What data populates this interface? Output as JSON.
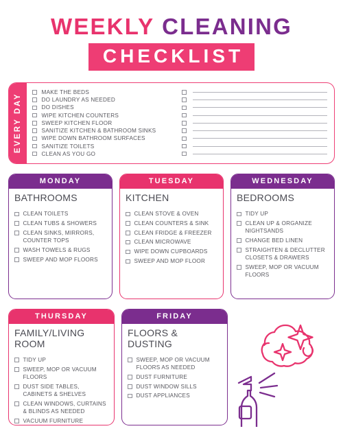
{
  "title": {
    "word1": "WEEKLY",
    "word2": "CLEANING",
    "banner": "CHECKLIST",
    "color_pink": "#e8336d",
    "color_purple": "#7b2d8e",
    "color_banner": "#ee3d74"
  },
  "every_day": {
    "label": "EVERY DAY",
    "tasks_left": [
      "MAKE THE BEDS",
      "DO LAUNDRY AS NEEDED",
      "DO DISHES",
      "WIPE KITCHEN COUNTERS",
      "SWEEP KITCHEN FLOOR",
      "SANITIZE KITCHEN & BATHROOM SINKS",
      "WIPE DOWN BATHROOM SURFACES",
      "SANITIZE TOILETS",
      "CLEAN AS YOU GO"
    ],
    "blank_lines_count": 9
  },
  "days": [
    {
      "day": "MONDAY",
      "room": "BATHROOMS",
      "accent": "#7b2d8e",
      "tasks": [
        "CLEAN TOILETS",
        "CLEAN TUBS & SHOWERS",
        "CLEAN SINKS, MIRRORS, COUNTER TOPS",
        "WASH TOWELS & RUGS",
        "SWEEP AND MOP FLOORS"
      ]
    },
    {
      "day": "TUESDAY",
      "room": "KITCHEN",
      "accent": "#e8336d",
      "tasks": [
        "CLEAN STOVE & OVEN",
        "CLEAN COUNTERS & SINK",
        "CLEAN FRIDGE & FREEZER",
        "CLEAN MICROWAVE",
        "WIPE DOWN CUPBOARDS",
        "SWEEP AND MOP FLOOR"
      ]
    },
    {
      "day": "WEDNESDAY",
      "room": "BEDROOMS",
      "accent": "#7b2d8e",
      "tasks": [
        "TIDY UP",
        "CLEAN UP & ORGANIZE NIGHTSANDS",
        "CHANGE BED LINEN",
        "STRAIGHTEN & DECLUTTER CLOSETS & DRAWERS",
        "SWEEP, MOP OR VACUUM FLOORS"
      ]
    },
    {
      "day": "THURSDAY",
      "room": "FAMILY/LIVING ROOM",
      "accent": "#e8336d",
      "tasks": [
        "TIDY UP",
        "SWEEP, MOP OR VACUUM FLOORS",
        "DUST SIDE TABLES, CABINETS & SHELVES",
        "CLEAN WINDOWS, CURTAINS & BLINDS AS NEEDED",
        "VACUUM FURNITURE"
      ]
    },
    {
      "day": "FRIDAY",
      "room": "FLOORS & DUSTING",
      "accent": "#7b2d8e",
      "tasks": [
        "SWEEP, MOP OR VACUUM FLOORS AS NEEDED",
        "DUST FURNITURE",
        "DUST WINDOW SILLS",
        "DUST APPLIANCES"
      ]
    }
  ],
  "illustration": {
    "spray_bottle_color": "#7b2d8e",
    "cloud_color": "#e8336d"
  }
}
